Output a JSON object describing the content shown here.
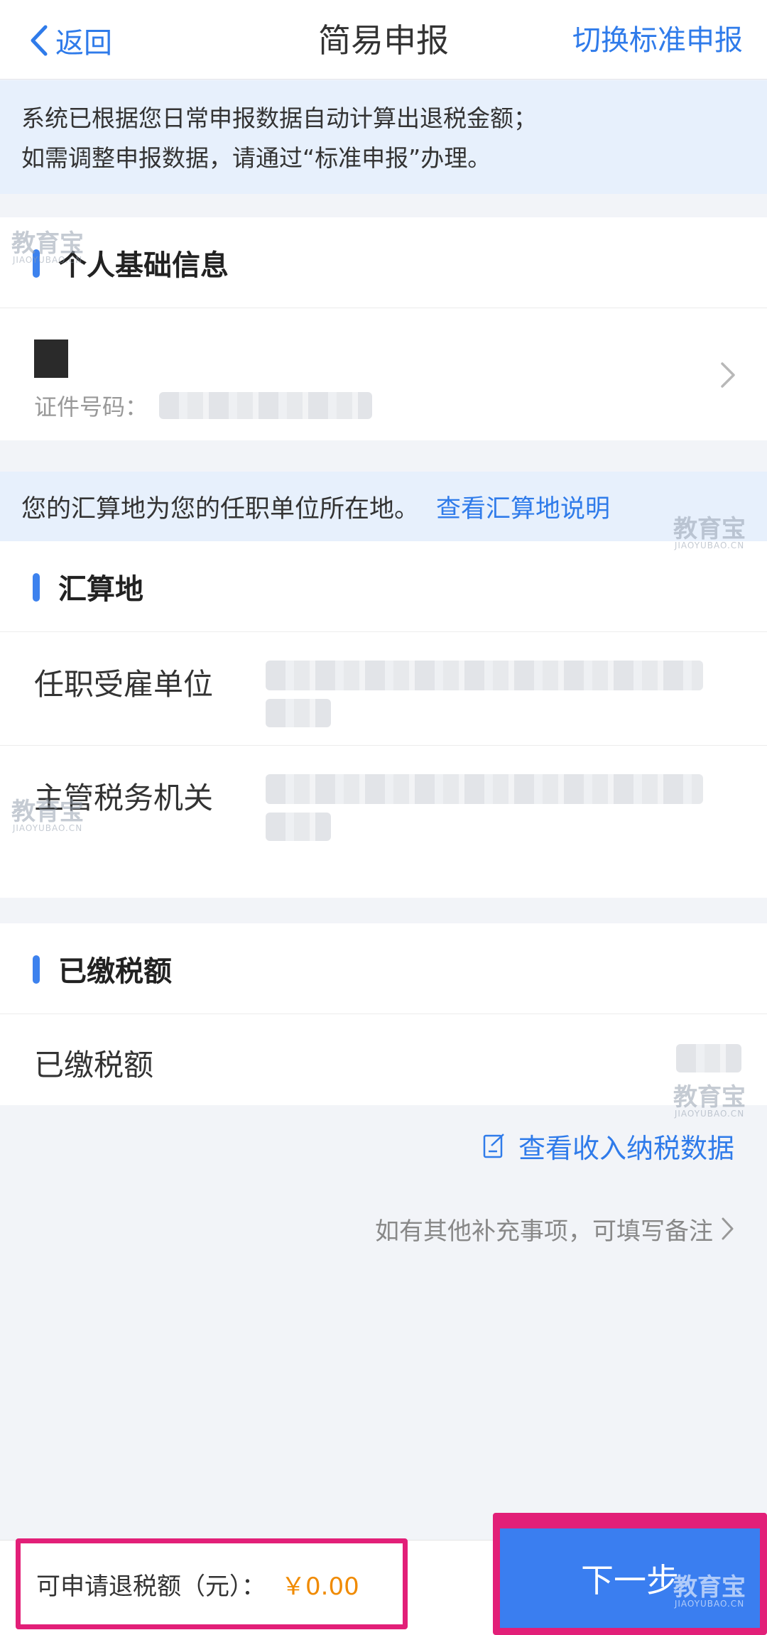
{
  "nav": {
    "back_label": "返回",
    "title": "简易申报",
    "switch_label": "切换标准申报"
  },
  "notice": {
    "line1": "系统已根据您日常申报数据自动计算出退税金额；",
    "line2": "如需调整申报数据，请通过“标准申报”办理。"
  },
  "personal": {
    "heading": "个人基础信息",
    "id_label": "证件号码："
  },
  "settlement_info": {
    "text": "您的汇算地为您的任职单位所在地。",
    "link": "查看汇算地说明"
  },
  "settlement": {
    "heading": "汇算地",
    "employer_label": "任职受雇单位",
    "tax_office_label": "主管税务机关"
  },
  "paid": {
    "heading": "已缴税额",
    "row_label": "已缴税额"
  },
  "actions": {
    "view_data": "查看收入纳税数据",
    "remark": "如有其他补充事项，可填写备注"
  },
  "footer": {
    "refund_label": "可申请退税额（元）：",
    "refund_amount": "￥0.00",
    "next_label": "下一步"
  },
  "watermark": {
    "title": "教育宝",
    "domain": "JIAOYUBAO.CN"
  },
  "colors": {
    "accent": "#2f7bea",
    "highlight": "#e21f78",
    "amount": "#f08a00"
  }
}
